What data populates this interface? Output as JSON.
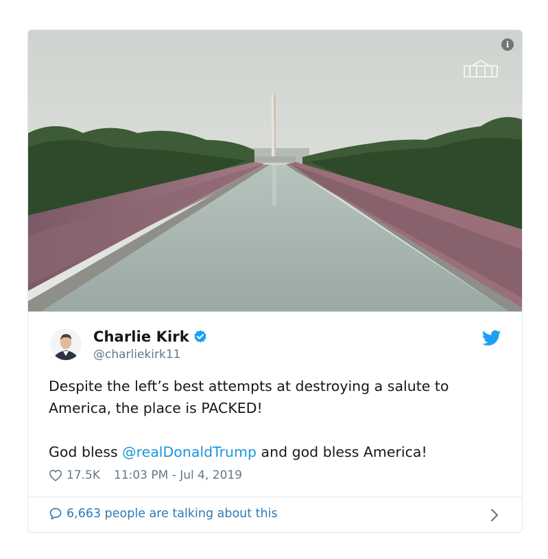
{
  "tweet": {
    "author_name": "Charlie Kirk",
    "author_handle": "@charliekirk11",
    "text_line1": "Despite the left’s best attempts at destroying a salute to America, the place is PACKED!",
    "text_line2_prefix": "God bless ",
    "mention": "@realDonaldTrump",
    "text_line2_suffix": " and god bless America!",
    "likes": "17.5K",
    "timestamp": "11:03 PM - Jul 4, 2019"
  },
  "footer": {
    "talking_text": "6,663 people are talking about this"
  },
  "icons": {
    "info": "info-icon",
    "verified": "verified-badge-icon",
    "bird": "twitter-bird-icon",
    "heart": "heart-icon",
    "bubble": "speech-bubble-icon",
    "chevron": "chevron-right-icon"
  },
  "colors": {
    "link": "#1b95e0",
    "footer_link": "#2b7bb9",
    "muted": "#657786",
    "text": "#14171a",
    "border": "#e1e8ed"
  }
}
